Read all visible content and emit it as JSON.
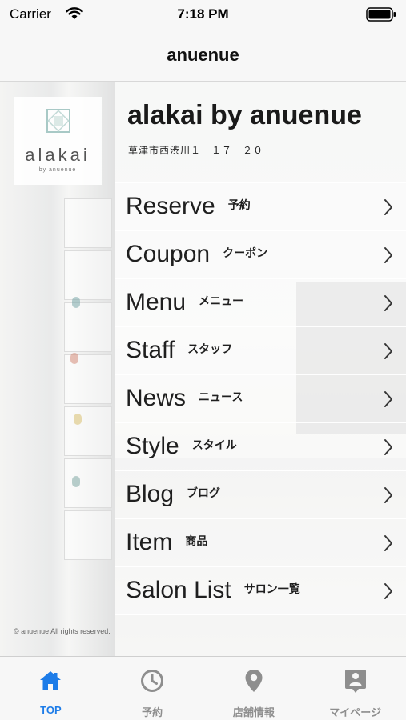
{
  "status_bar": {
    "carrier": "Carrier",
    "time": "7:18 PM"
  },
  "nav": {
    "title": "anuenue"
  },
  "logo": {
    "text": "alakai",
    "subtext": "by anuenue"
  },
  "shop": {
    "name": "alakai by anuenue",
    "address": "草津市西渋川１－１７－２０"
  },
  "menu": [
    {
      "label": "Reserve",
      "sub": "予約",
      "icon": "chevron-right-icon"
    },
    {
      "label": "Coupon",
      "sub": "クーポン",
      "icon": "chevron-right-icon"
    },
    {
      "label": "Menu",
      "sub": "メニュー",
      "icon": "chevron-right-icon"
    },
    {
      "label": "Staff",
      "sub": "スタッフ",
      "icon": "chevron-right-icon"
    },
    {
      "label": "News",
      "sub": "ニュース",
      "icon": "chevron-right-icon"
    },
    {
      "label": "Style",
      "sub": "スタイル",
      "icon": "chevron-right-icon"
    },
    {
      "label": "Blog",
      "sub": "ブログ",
      "icon": "chevron-right-icon"
    },
    {
      "label": "Item",
      "sub": "商品",
      "icon": "chevron-right-icon"
    },
    {
      "label": "Salon List",
      "sub": "サロン一覧",
      "icon": "chevron-right-icon"
    }
  ],
  "copyright": "© anuenue All rights reserved.",
  "tabs": [
    {
      "label": "TOP",
      "icon": "home-icon",
      "active": true
    },
    {
      "label": "予約",
      "icon": "clock-icon",
      "active": false
    },
    {
      "label": "店舗情報",
      "icon": "map-pin-icon",
      "active": false
    },
    {
      "label": "マイページ",
      "icon": "id-card-icon",
      "active": false
    }
  ],
  "colors": {
    "accent": "#1d7ce8",
    "inactive_tab": "#8e8e8e",
    "bar_background": "#f7f7f7"
  }
}
